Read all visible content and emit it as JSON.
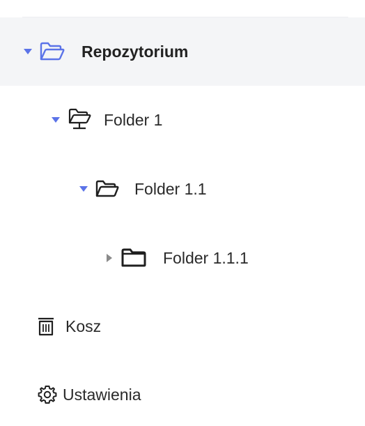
{
  "tree": {
    "items": [
      {
        "label": "Repozytorium",
        "expanded": true,
        "selected": true,
        "icon": "folder-open-icon"
      },
      {
        "label": "Folder 1",
        "expanded": true,
        "icon": "folder-shared-icon"
      },
      {
        "label": "Folder 1.1",
        "expanded": true,
        "icon": "folder-open-icon"
      },
      {
        "label": "Folder 1.1.1",
        "expanded": false,
        "icon": "folder-closed-icon"
      }
    ]
  },
  "nav": {
    "trash_label": "Kosz",
    "settings_label": "Ustawienia"
  },
  "colors": {
    "accent": "#5b73e8",
    "selected_bg": "#f4f5f7",
    "text": "#222222",
    "icon_dark": "#1f1f1f",
    "caret_collapsed": "#8a8a8a"
  }
}
